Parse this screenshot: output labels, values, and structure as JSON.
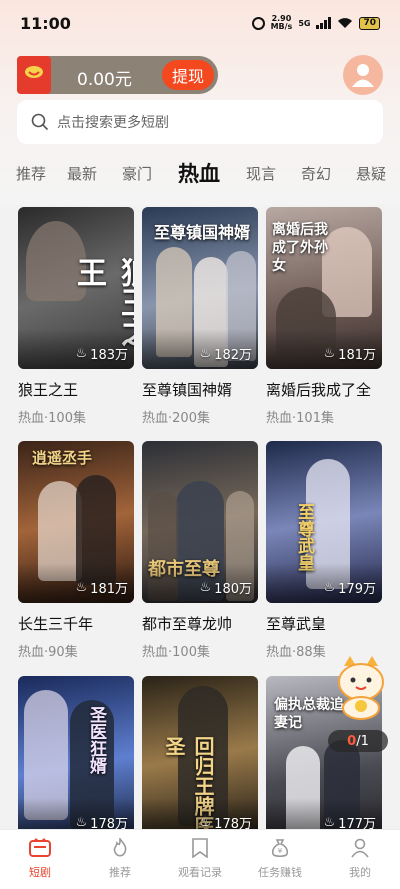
{
  "status_bar": {
    "time": "11:00",
    "speed_value": "2.90",
    "speed_unit": "MB/s",
    "network": "5G",
    "battery": "70"
  },
  "wallet": {
    "amount": "0.00元",
    "withdraw_label": "提现"
  },
  "search": {
    "placeholder": "点击搜索更多短剧"
  },
  "tabs": [
    "推荐",
    "最新",
    "豪门",
    "热血",
    "现言",
    "奇幻",
    "悬疑"
  ],
  "active_tab": "热血",
  "dramas": [
    {
      "poster_title": "狼王之王",
      "views": "183万",
      "title": "狼王之王",
      "genre": "热血",
      "episodes": "100集",
      "colors": [
        "#3a3a3a",
        "#6b6b6b"
      ]
    },
    {
      "poster_title": "至尊镇国神婿",
      "views": "182万",
      "title": "至尊镇国神婿",
      "genre": "热血",
      "episodes": "200集",
      "colors": [
        "#2b3a55",
        "#8896ad"
      ]
    },
    {
      "poster_title": "离婚后我成了外孙女",
      "views": "181万",
      "title": "离婚后我成了全",
      "genre": "热血",
      "episodes": "101集",
      "colors": [
        "#6d5a55",
        "#c7b3ab"
      ]
    },
    {
      "poster_title": "逍遥丞手",
      "views": "181万",
      "title": "长生三千年",
      "genre": "热血",
      "episodes": "90集",
      "colors": [
        "#3a2418",
        "#a2643a"
      ]
    },
    {
      "poster_title": "都市至尊",
      "views": "180万",
      "title": "都市至尊龙帅",
      "genre": "热血",
      "episodes": "100集",
      "colors": [
        "#2c2f36",
        "#76685a"
      ]
    },
    {
      "poster_title": "至尊武皇",
      "views": "179万",
      "title": "至尊武皇",
      "genre": "热血",
      "episodes": "88集",
      "colors": [
        "#1e2a4a",
        "#7a86b8"
      ]
    },
    {
      "poster_title": "圣医狂婿",
      "views": "178万",
      "title": "",
      "genre": "",
      "episodes": "",
      "colors": [
        "#1a2a5a",
        "#5e7fd0"
      ]
    },
    {
      "poster_title": "回归王牌医圣",
      "views": "178万",
      "title": "",
      "genre": "",
      "episodes": "",
      "colors": [
        "#2a2318",
        "#9a7a4a"
      ]
    },
    {
      "poster_title": "偏执总裁追妻记",
      "views": "177万",
      "title": "",
      "genre": "",
      "episodes": "",
      "colors": [
        "#4a4a52",
        "#b8b8c0"
      ]
    }
  ],
  "float_counter": {
    "current": "0",
    "total": "/1"
  },
  "nav": [
    {
      "label": "短剧",
      "icon": "tv-icon",
      "active": true
    },
    {
      "label": "推荐",
      "icon": "flame-icon",
      "active": false
    },
    {
      "label": "观看记录",
      "icon": "bookmark-icon",
      "active": false
    },
    {
      "label": "任务赚钱",
      "icon": "money-bag-icon",
      "active": false
    },
    {
      "label": "我的",
      "icon": "person-icon",
      "active": false
    }
  ],
  "colors": {
    "accent": "#e8442e",
    "withdraw": "#f4481f",
    "wallet_bg": "#8c8276"
  }
}
